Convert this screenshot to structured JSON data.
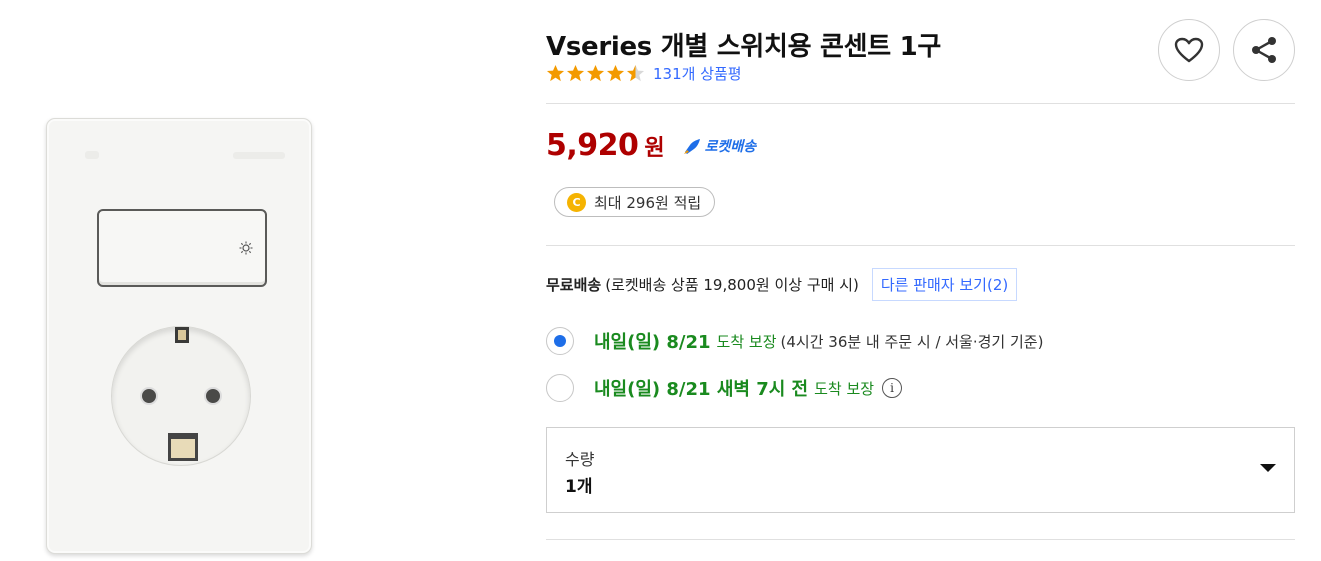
{
  "product": {
    "title": "Vseries 개별 스위치용 콘센트 1구",
    "rating": 4.5,
    "review_count_label": "131개 상품평"
  },
  "actions": {
    "wish_icon": "heart-icon",
    "share_icon": "share-icon"
  },
  "price": {
    "value": "5,920",
    "unit": "원",
    "rocket_label": "로켓배송",
    "cash_label": "최대 296원 적립",
    "cash_icon_text": "C"
  },
  "shipping": {
    "free_label": "무료배송",
    "condition": "(로켓배송 상품 19,800원 이상 구매 시)",
    "other_sellers": "다른 판매자 보기(2)"
  },
  "delivery_options": [
    {
      "selected": true,
      "main": "내일(일) 8/21",
      "sub": "도착 보장",
      "note": "(4시간 36분 내 주문 시 / 서울·경기 기준)"
    },
    {
      "selected": false,
      "main": "내일(일) 8/21 새벽 7시 전",
      "sub": "도착 보장",
      "info_icon": "i"
    }
  ],
  "quantity": {
    "label": "수량",
    "value": "1개"
  },
  "colors": {
    "price": "#ae0000",
    "link": "#346aff",
    "delivery": "#1a8a1f",
    "star": "#f39a00",
    "radio": "#1e6ee8"
  }
}
